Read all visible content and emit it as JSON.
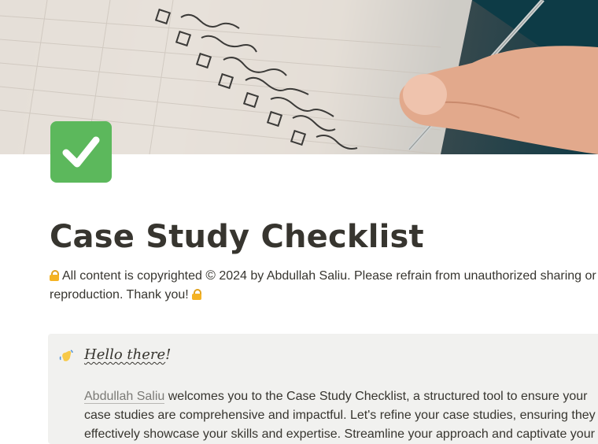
{
  "cover": {
    "image": "notebook-checklist-cover"
  },
  "page_icon": {
    "name": "check-mark-button-icon"
  },
  "title": "Case Study Checklist",
  "notice": {
    "prefix": "All content is copyrighted",
    "copyright_symbol": "©",
    "suffix": "2024 by Abdullah Saliu. Please refrain from unauthorized sharing or reproduction. Thank you!"
  },
  "callout": {
    "icon": "waving-hand-icon",
    "title_word": "Hello there",
    "title_punct": "!",
    "author_link": "Abdullah Saliu",
    "body": "welcomes you to the Case Study Checklist, a structured tool to ensure your case studies are comprehensive and impactful. Let's refine your case studies, ensuring they effectively showcase your skills and expertise. Streamline your approach and captivate your"
  },
  "colors": {
    "icon_green": "#5cb85c",
    "callout_bg": "#f1f1ef",
    "text": "#37352f"
  }
}
